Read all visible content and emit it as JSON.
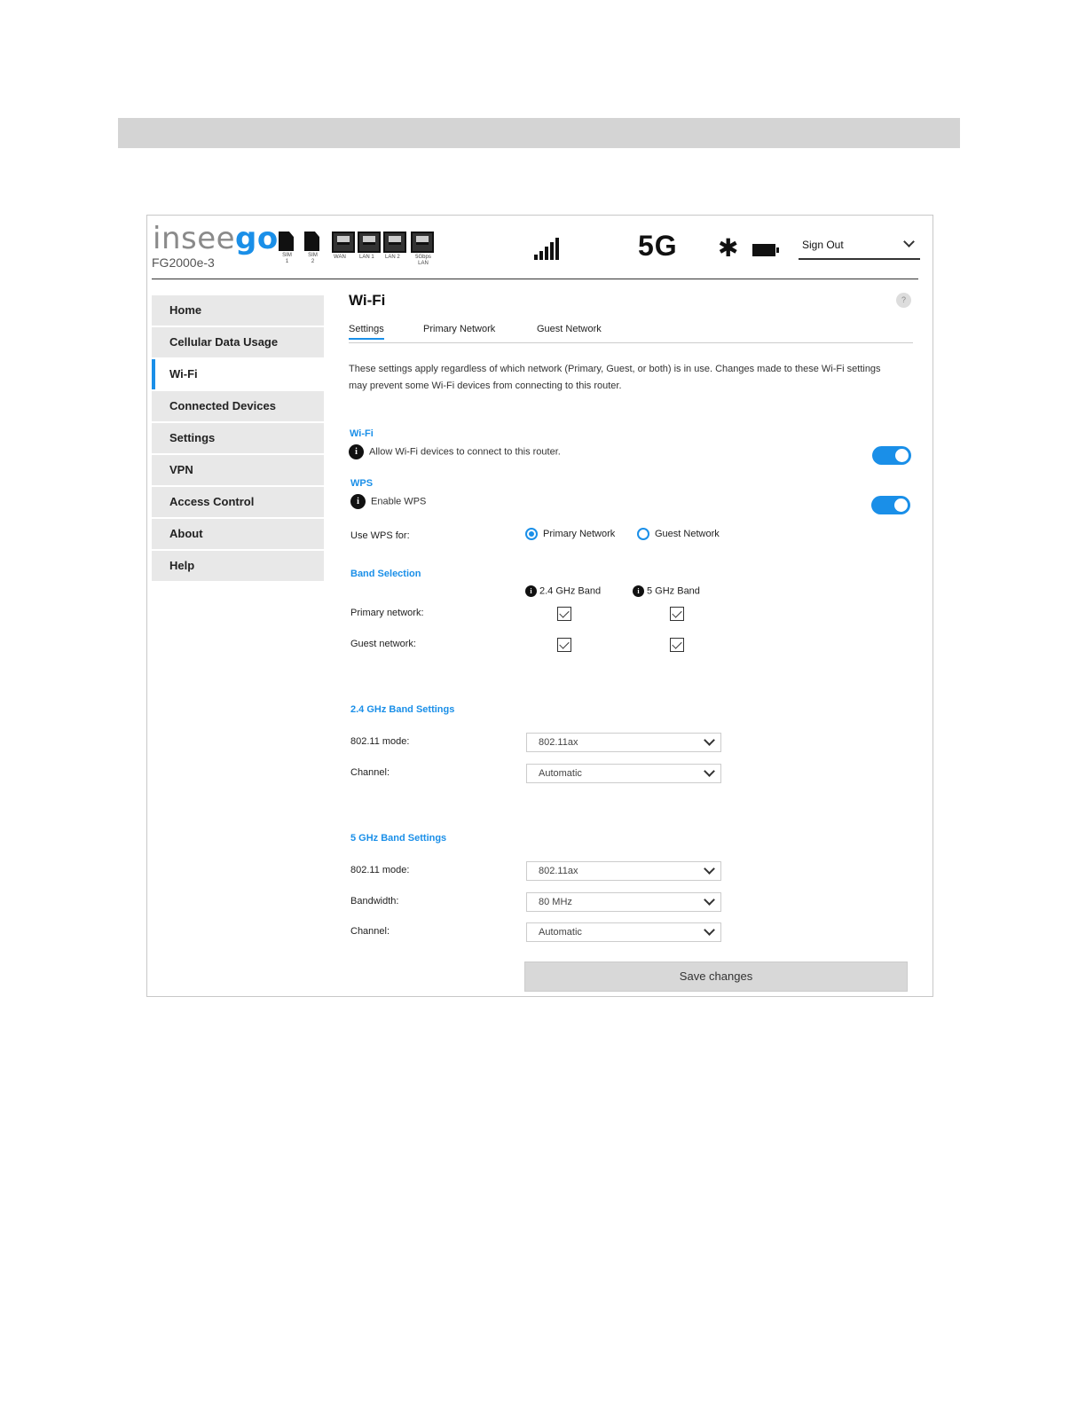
{
  "header": {
    "logo_prefix": "inseego",
    "logo_accent": "go",
    "model": "FG2000e-3",
    "status_icons": [
      {
        "name": "sim1-icon",
        "label": "SIM 1",
        "kind": "sim"
      },
      {
        "name": "sim2-icon",
        "label": "SIM 2",
        "kind": "sim"
      },
      {
        "name": "wan-port-icon",
        "label": "WAN",
        "kind": "port"
      },
      {
        "name": "lan1-port-icon",
        "label": "LAN 1",
        "kind": "port"
      },
      {
        "name": "lan2-port-icon",
        "label": "LAN 2",
        "kind": "port"
      },
      {
        "name": "lan-5gbps-port-icon",
        "label": "5Gbps LAN",
        "kind": "port"
      }
    ],
    "network_type": "5G",
    "bluetooth_icon": "bluetooth-icon",
    "battery_icon": "battery-icon",
    "signal_icon": "signal-strength-icon",
    "signout_label": "Sign Out"
  },
  "sidebar": {
    "items": [
      {
        "label": "Home",
        "active": false
      },
      {
        "label": "Cellular Data Usage",
        "active": false
      },
      {
        "label": "Wi-Fi",
        "active": true
      },
      {
        "label": "Connected Devices",
        "active": false
      },
      {
        "label": "Settings",
        "active": false
      },
      {
        "label": "VPN",
        "active": false
      },
      {
        "label": "Access Control",
        "active": false
      },
      {
        "label": "About",
        "active": false
      },
      {
        "label": "Help",
        "active": false
      }
    ]
  },
  "main": {
    "title": "Wi-Fi",
    "help_label": "?",
    "tabs": [
      {
        "label": "Settings",
        "active": true
      },
      {
        "label": "Primary Network",
        "active": false
      },
      {
        "label": "Guest Network",
        "active": false
      }
    ],
    "description": "These settings apply regardless of which network (Primary, Guest, or both) is in use. Changes made to these Wi-Fi settings may prevent some Wi-Fi devices from connecting to this router.",
    "wifi": {
      "heading": "Wi-Fi",
      "info": "Allow Wi-Fi devices to connect to this router.",
      "enabled": true
    },
    "wps": {
      "heading": "WPS",
      "info": "Enable WPS",
      "enabled": true,
      "use_for_label": "Use WPS for:",
      "options": [
        {
          "label": "Primary Network",
          "selected": true
        },
        {
          "label": "Guest Network",
          "selected": false
        }
      ]
    },
    "band_selection": {
      "heading": "Band Selection",
      "bands": [
        "2.4 GHz Band",
        "5 GHz Band"
      ],
      "rows": [
        {
          "label": "Primary network:",
          "checked": [
            true,
            true
          ]
        },
        {
          "label": "Guest network:",
          "checked": [
            true,
            true
          ]
        }
      ]
    },
    "band24": {
      "heading": "2.4 GHz Band Settings",
      "mode_label": "802.11 mode:",
      "mode_value": "802.11ax",
      "channel_label": "Channel:",
      "channel_value": "Automatic"
    },
    "band5": {
      "heading": "5 GHz Band Settings",
      "mode_label": "802.11 mode:",
      "mode_value": "802.11ax",
      "bandwidth_label": "Bandwidth:",
      "bandwidth_value": "80 MHz",
      "channel_label": "Channel:",
      "channel_value": "Automatic"
    },
    "save_label": "Save changes"
  },
  "colors": {
    "accent": "#1a8fe8",
    "nav_bg": "#e8e8e8",
    "button_bg": "#d8d8d8",
    "top_bar": "#d4d4d4"
  }
}
